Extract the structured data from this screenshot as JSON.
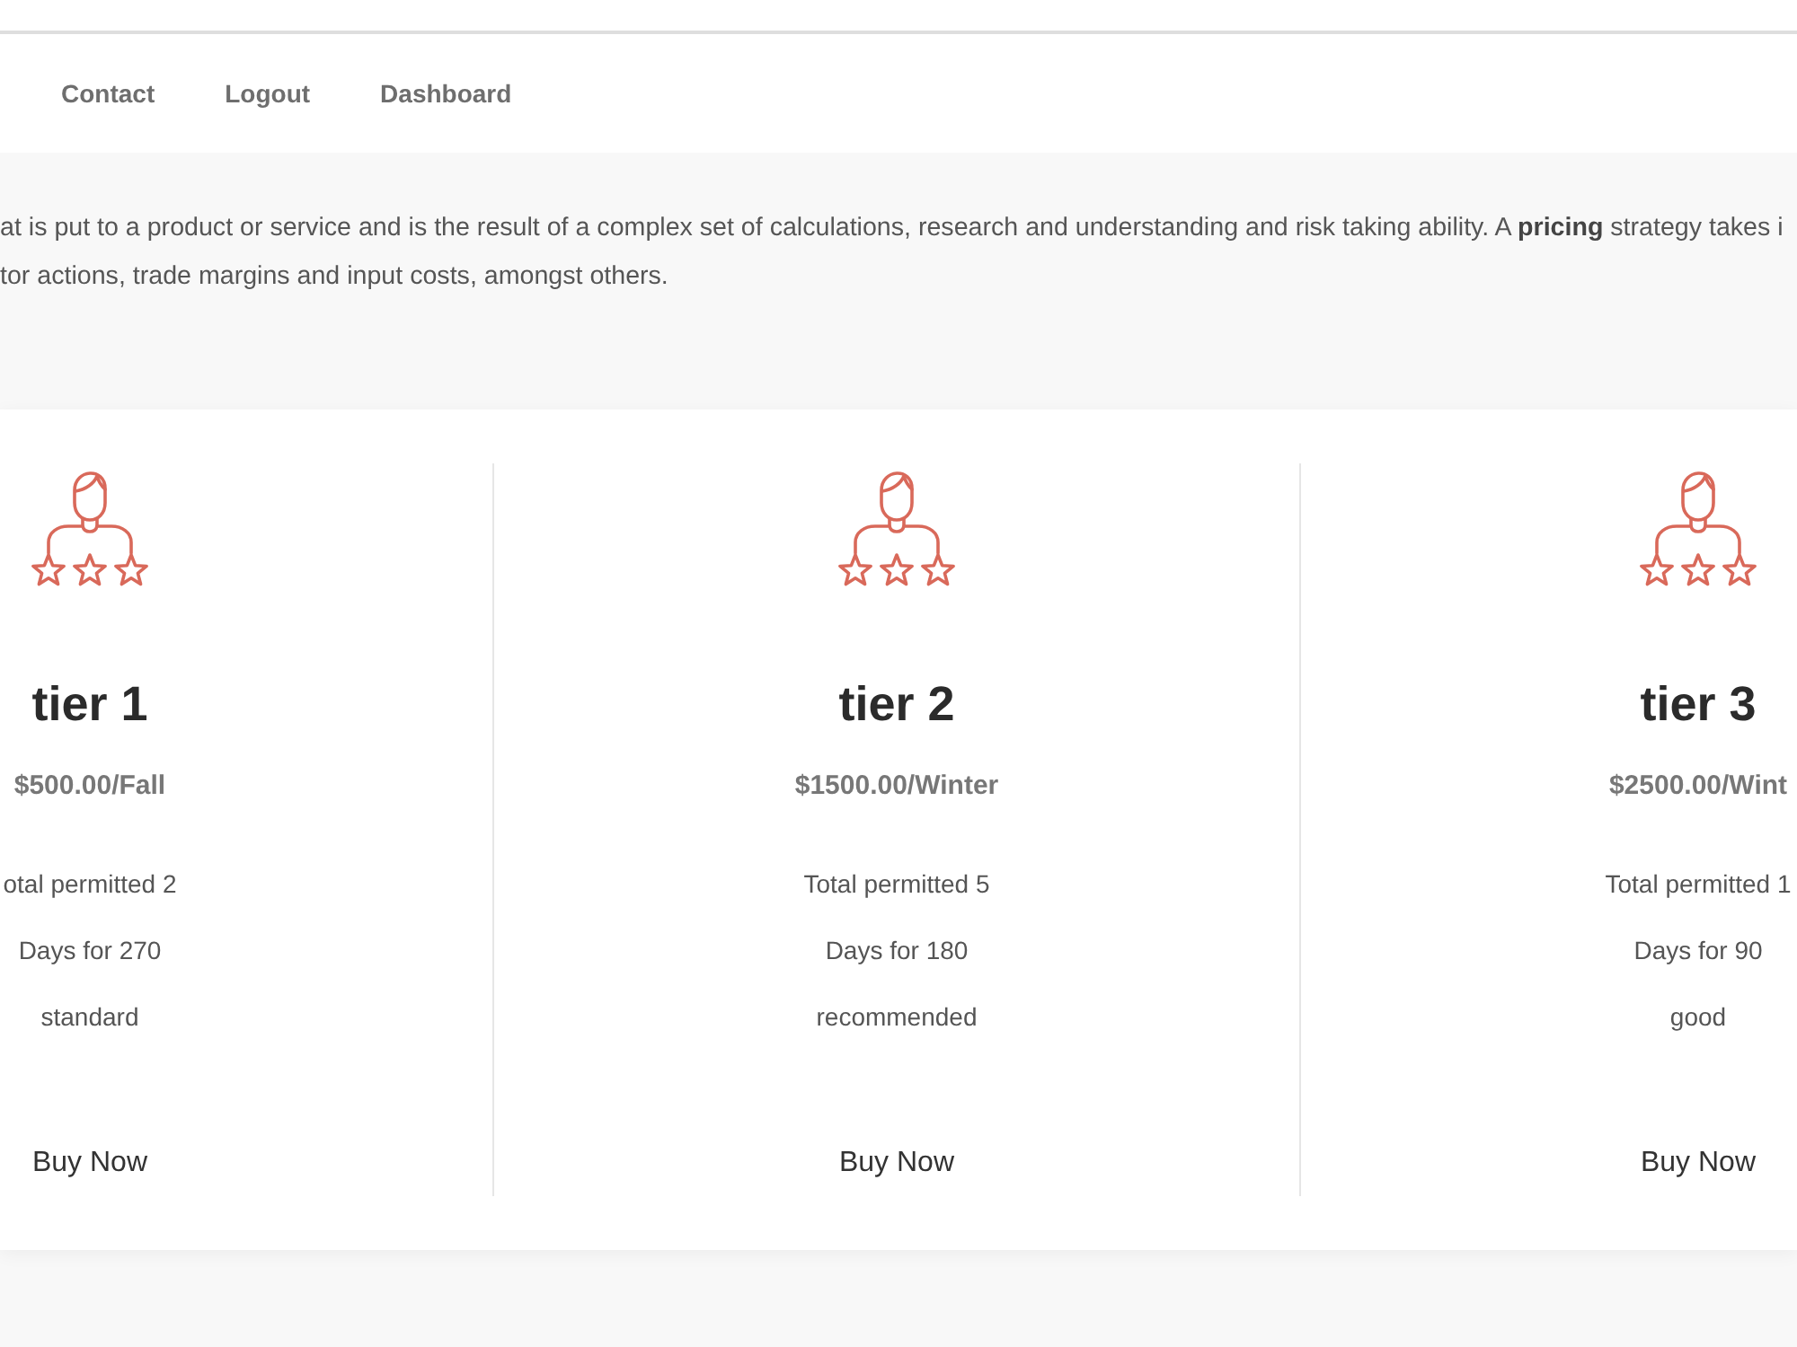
{
  "nav": {
    "links": [
      "Contact",
      "Logout",
      "Dashboard"
    ]
  },
  "intro": {
    "lines": [
      "at is put to a product or service and is the result of a complex set of calculations, research and understanding and risk taking ability. A **pricing** strategy takes i",
      "tor actions, trade margins and input costs, amongst others."
    ]
  },
  "pricing": {
    "plans": [
      {
        "title": "tier 1",
        "price": "$500.00/Fall",
        "features": [
          "otal permitted 2",
          "Days for 270",
          "standard"
        ],
        "button": "Buy Now"
      },
      {
        "title": "tier 2",
        "price": "$1500.00/Winter",
        "features": [
          "Total permitted 5",
          "Days for 180",
          "recommended"
        ],
        "button": "Buy Now"
      },
      {
        "title": "tier 3",
        "price": "$2500.00/Wint",
        "features": [
          "Total permitted 1",
          "Days for 90",
          "good"
        ],
        "button": "Buy Now"
      }
    ]
  }
}
